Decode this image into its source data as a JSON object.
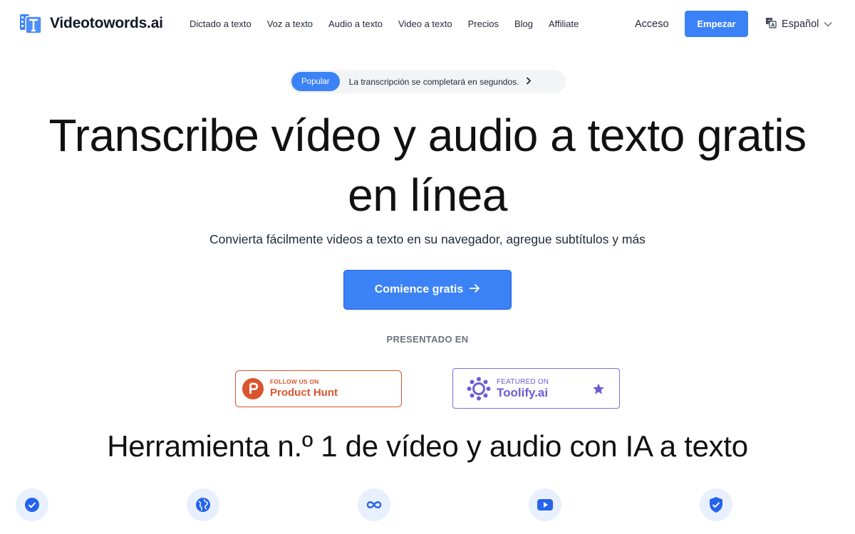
{
  "header": {
    "brand": "Videotowords.ai",
    "nav": [
      {
        "label": "Dictado a texto"
      },
      {
        "label": "Voz a texto"
      },
      {
        "label": "Audio a texto"
      },
      {
        "label": "Video a texto"
      },
      {
        "label": "Precios"
      },
      {
        "label": "Blog"
      },
      {
        "label": "Affiliate"
      }
    ],
    "login_label": "Acceso",
    "start_label": "Empezar",
    "language": "Español"
  },
  "announcement": {
    "badge": "Popular",
    "text": "La transcripción se completará en segundos."
  },
  "hero": {
    "title_line1": "Transcribe vídeo y audio a texto gratis",
    "title_line2": "en línea",
    "subtitle": "Convierta fácilmente videos a texto en su navegador, agregue subtítulos y más",
    "cta_label": "Comience gratis"
  },
  "featured": {
    "label": "PRESENTADO EN",
    "product_hunt": {
      "small": "FOLLOW US ON",
      "big": "Product Hunt"
    },
    "toolify": {
      "small": "FEATURED ON",
      "big": "Toolify.ai"
    }
  },
  "section": {
    "title": "Herramienta n.º 1 de vídeo y audio con IA a texto"
  },
  "feature_icons": [
    "check-circle-icon",
    "globe-icon",
    "infinity-icon",
    "youtube-icon",
    "shield-check-icon"
  ],
  "colors": {
    "accent": "#3b82f6",
    "product_hunt": "#da552f",
    "toolify": "#6d5dd3",
    "icon_bg": "#e8f0fe"
  }
}
